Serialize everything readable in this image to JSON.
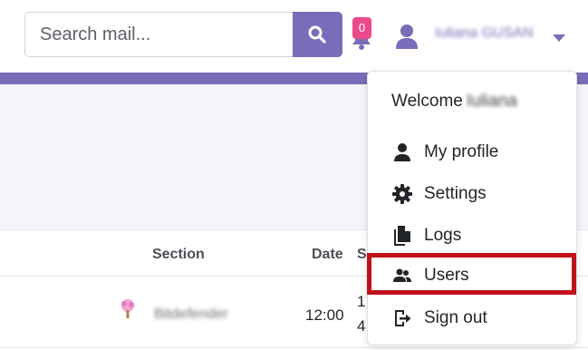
{
  "search": {
    "placeholder": "Search mail..."
  },
  "notifications": {
    "count": "0"
  },
  "user": {
    "name": "Iuliana GUSAN"
  },
  "dropdown": {
    "welcome_label": "Welcome",
    "welcome_name": "Iuliana",
    "items": [
      {
        "label": "My profile",
        "icon": "person-icon"
      },
      {
        "label": "Settings",
        "icon": "gear-icon"
      },
      {
        "label": "Logs",
        "icon": "file-icon"
      },
      {
        "label": "Users",
        "icon": "users-icon"
      },
      {
        "label": "Sign out",
        "icon": "sign-out-icon"
      }
    ]
  },
  "table": {
    "columns": {
      "section": "Section",
      "date": "Date",
      "s": "S"
    },
    "row": {
      "section": "Bitdefender",
      "date": "12:00",
      "s1": "1",
      "s2": "4"
    }
  },
  "colors": {
    "accent": "#7a6cb8",
    "badge": "#ec4a8c",
    "highlight": "#c0111b"
  }
}
